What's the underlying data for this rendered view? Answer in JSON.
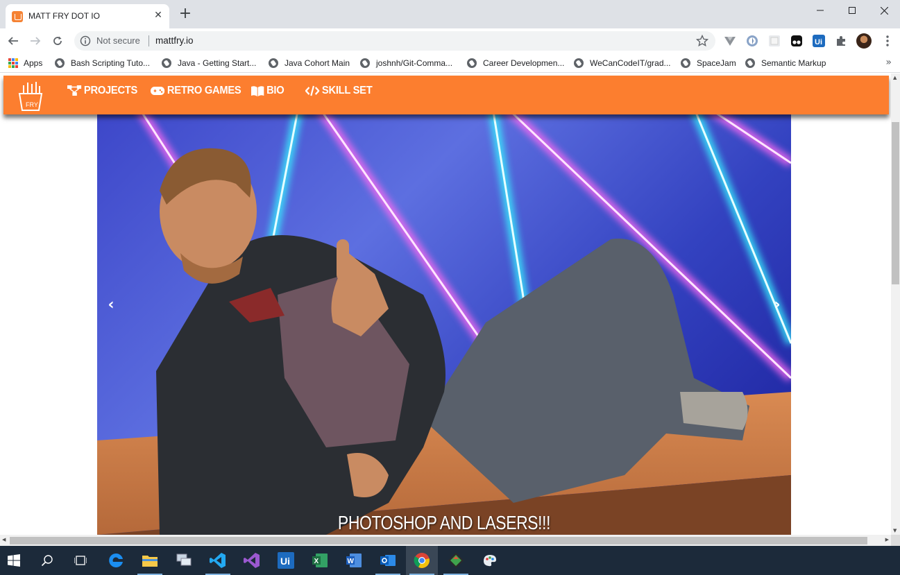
{
  "browser": {
    "tab_title": "MATT FRY DOT IO",
    "new_tab_symbol": "+",
    "security_label": "Not secure",
    "url": "mattfry.io",
    "bookmarks": [
      {
        "label": "Apps",
        "icon": "apps-grid-icon"
      },
      {
        "label": "Bash Scripting Tuto...",
        "icon": "globe-icon"
      },
      {
        "label": "Java - Getting Start...",
        "icon": "globe-icon"
      },
      {
        "label": "Java Cohort Main",
        "icon": "globe-icon"
      },
      {
        "label": "joshnh/Git-Comma...",
        "icon": "globe-icon"
      },
      {
        "label": "Career Developmen...",
        "icon": "globe-icon"
      },
      {
        "label": "WeCanCodeIT/grad...",
        "icon": "globe-icon"
      },
      {
        "label": "SpaceJam",
        "icon": "globe-icon"
      },
      {
        "label": "Semantic Markup",
        "icon": "globe-icon"
      }
    ],
    "bookmarks_overflow": "»"
  },
  "site": {
    "logo_text": "FRY",
    "nav": [
      {
        "label": "PROJECTS",
        "icon": "sitemap-icon"
      },
      {
        "label": "RETRO GAMES",
        "icon": "gamepad-icon"
      },
      {
        "label": "BIO",
        "icon": "book-icon"
      },
      {
        "label": "SKILL SET",
        "icon": "code-icon"
      }
    ],
    "carousel": {
      "caption": "PHOTOSHOP AND LASERS!!!",
      "prev_symbol": "‹",
      "next_symbol": "›"
    }
  },
  "taskbar": {
    "apps": [
      "start",
      "search",
      "task-view",
      "edge",
      "file-explorer",
      "network",
      "vscode",
      "visual-studio",
      "uipath",
      "excel",
      "word",
      "outlook",
      "chrome",
      "git",
      "paint"
    ]
  },
  "colors": {
    "nav_orange": "#fc7e2f",
    "chrome_frame": "#dee1e6",
    "taskbar": "#1c2a3a"
  }
}
